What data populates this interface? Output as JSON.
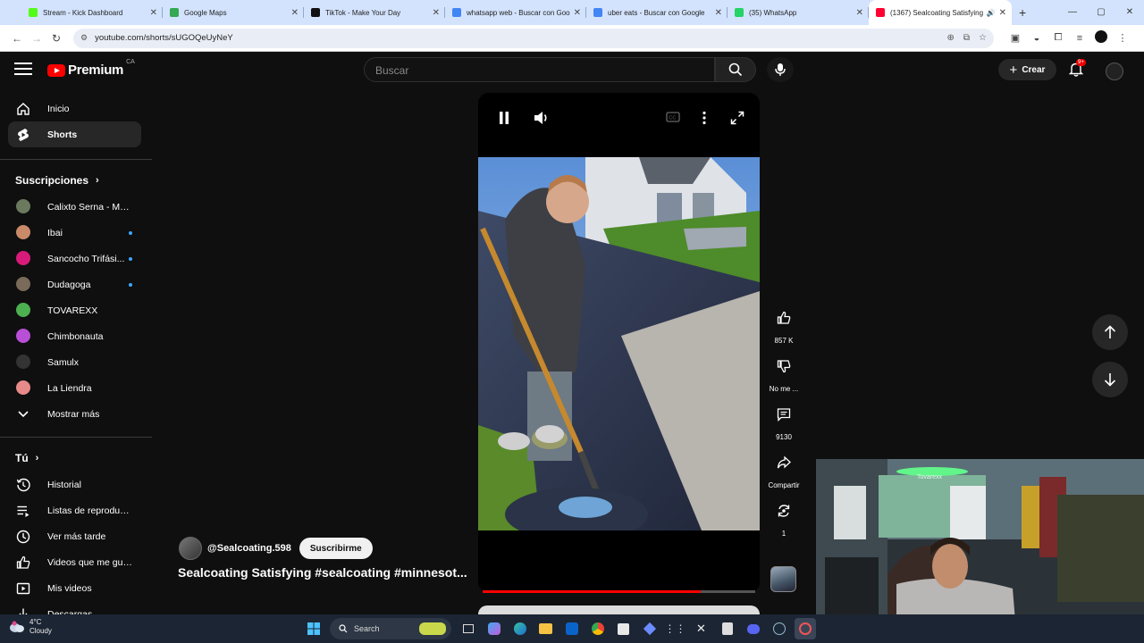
{
  "browser": {
    "tabs": [
      {
        "title": "Stream - Kick Dashboard",
        "fav": "#53fc18"
      },
      {
        "title": "Google Maps",
        "fav": "#34a853"
      },
      {
        "title": "TikTok - Make Your Day",
        "fav": "#111111"
      },
      {
        "title": "whatsapp web - Buscar con Google",
        "fav": "#4285f4"
      },
      {
        "title": "uber eats - Buscar con Google",
        "fav": "#4285f4"
      },
      {
        "title": "(35) WhatsApp",
        "fav": "#25d366"
      },
      {
        "title": "(1367) Sealcoating Satisfying",
        "fav": "#ff0033"
      }
    ],
    "url": "youtube.com/shorts/sUGOQeUyNeY"
  },
  "masthead": {
    "logo_text": "Premium",
    "country": "CA",
    "search_placeholder": "Buscar",
    "create_label": "Crear",
    "notif_badge": "9+"
  },
  "sidebar": {
    "main": [
      {
        "label": "Inicio",
        "icon": "home-icon"
      },
      {
        "label": "Shorts",
        "icon": "shorts-icon"
      }
    ],
    "subs_title": "Suscripciones",
    "subscriptions": [
      {
        "label": "Calixto Serna - Méx...",
        "color": "#6b7a5e",
        "dot": false
      },
      {
        "label": "Ibai",
        "color": "#c98a6a",
        "dot": true
      },
      {
        "label": "Sancocho Trifási...",
        "color": "#d81b7a",
        "dot": true
      },
      {
        "label": "Dudagoga",
        "color": "#7a6a5a",
        "dot": true
      },
      {
        "label": "TOVAREXX",
        "color": "#4caf50",
        "dot": false
      },
      {
        "label": "Chimbonauta",
        "color": "#b84fd6",
        "dot": false
      },
      {
        "label": "Samulx",
        "color": "#333333",
        "dot": false
      },
      {
        "label": "La Liendra",
        "color": "#e88a8a",
        "dot": false
      }
    ],
    "show_more": "Mostrar más",
    "you_title": "Tú",
    "you_items": [
      {
        "label": "Historial",
        "icon": "history-icon"
      },
      {
        "label": "Listas de reproducción",
        "icon": "playlists-icon"
      },
      {
        "label": "Ver más tarde",
        "icon": "watch-later-icon"
      },
      {
        "label": "Videos que me gustan",
        "icon": "like-icon"
      },
      {
        "label": "Mis videos",
        "icon": "my-videos-icon"
      },
      {
        "label": "Descargas",
        "icon": "download-icon"
      }
    ]
  },
  "short": {
    "channel": "@Sealcoating.598",
    "subscribe_label": "Suscribirme",
    "title": "Sealcoating Satisfying #sealcoating #minnesot...",
    "progress_fraction": 0.8
  },
  "actions": {
    "likes": "857 K",
    "dislike": "No me ...",
    "comments": "9130",
    "share": "Compartir",
    "remix": "1"
  },
  "taskbar": {
    "temp": "4°C",
    "condition": "Cloudy",
    "search": "Search"
  },
  "webcam": {
    "sign": "Tovarexx"
  }
}
